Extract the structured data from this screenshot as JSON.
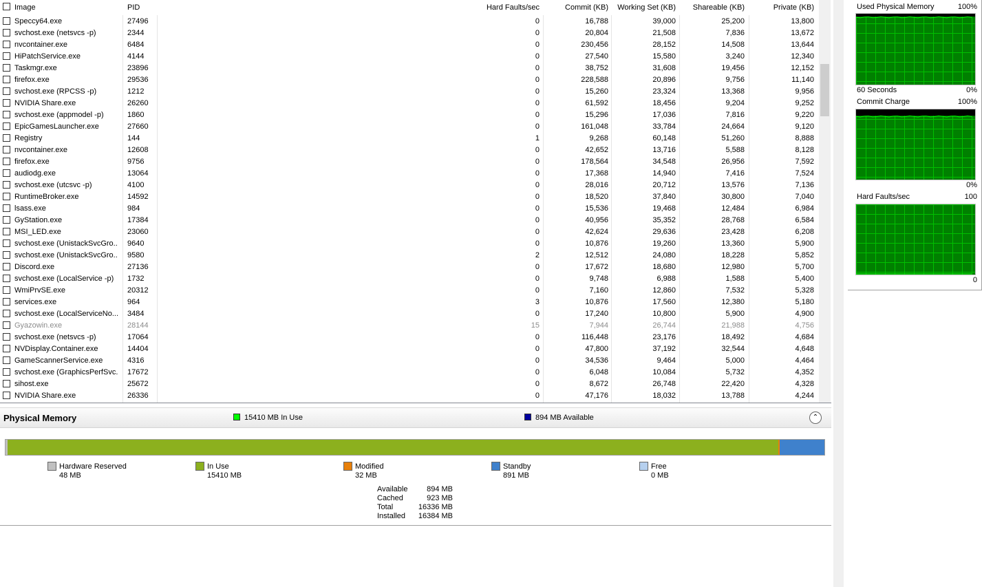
{
  "table": {
    "headers": {
      "image": "Image",
      "pid": "PID",
      "hard_faults": "Hard Faults/sec",
      "commit": "Commit (KB)",
      "working_set": "Working Set (KB)",
      "shareable": "Shareable (KB)",
      "private": "Private (KB)"
    },
    "rows": [
      {
        "image": "Speccy64.exe",
        "pid": "27496",
        "hf": "0",
        "commit": "16,788",
        "ws": "39,000",
        "shareable": "25,200",
        "private": "13,800"
      },
      {
        "image": "svchost.exe (netsvcs -p)",
        "pid": "2344",
        "hf": "0",
        "commit": "20,804",
        "ws": "21,508",
        "shareable": "7,836",
        "private": "13,672"
      },
      {
        "image": "nvcontainer.exe",
        "pid": "6484",
        "hf": "0",
        "commit": "230,456",
        "ws": "28,152",
        "shareable": "14,508",
        "private": "13,644"
      },
      {
        "image": "HiPatchService.exe",
        "pid": "4144",
        "hf": "0",
        "commit": "27,540",
        "ws": "15,580",
        "shareable": "3,240",
        "private": "12,340"
      },
      {
        "image": "Taskmgr.exe",
        "pid": "23896",
        "hf": "0",
        "commit": "38,752",
        "ws": "31,608",
        "shareable": "19,456",
        "private": "12,152"
      },
      {
        "image": "firefox.exe",
        "pid": "29536",
        "hf": "0",
        "commit": "228,588",
        "ws": "20,896",
        "shareable": "9,756",
        "private": "11,140"
      },
      {
        "image": "svchost.exe (RPCSS -p)",
        "pid": "1212",
        "hf": "0",
        "commit": "15,260",
        "ws": "23,324",
        "shareable": "13,368",
        "private": "9,956"
      },
      {
        "image": "NVIDIA Share.exe",
        "pid": "26260",
        "hf": "0",
        "commit": "61,592",
        "ws": "18,456",
        "shareable": "9,204",
        "private": "9,252"
      },
      {
        "image": "svchost.exe (appmodel -p)",
        "pid": "1860",
        "hf": "0",
        "commit": "15,296",
        "ws": "17,036",
        "shareable": "7,816",
        "private": "9,220"
      },
      {
        "image": "EpicGamesLauncher.exe",
        "pid": "27660",
        "hf": "0",
        "commit": "161,048",
        "ws": "33,784",
        "shareable": "24,664",
        "private": "9,120"
      },
      {
        "image": "Registry",
        "pid": "144",
        "hf": "1",
        "commit": "9,268",
        "ws": "60,148",
        "shareable": "51,260",
        "private": "8,888"
      },
      {
        "image": "nvcontainer.exe",
        "pid": "12608",
        "hf": "0",
        "commit": "42,652",
        "ws": "13,716",
        "shareable": "5,588",
        "private": "8,128"
      },
      {
        "image": "firefox.exe",
        "pid": "9756",
        "hf": "0",
        "commit": "178,564",
        "ws": "34,548",
        "shareable": "26,956",
        "private": "7,592"
      },
      {
        "image": "audiodg.exe",
        "pid": "13064",
        "hf": "0",
        "commit": "17,368",
        "ws": "14,940",
        "shareable": "7,416",
        "private": "7,524"
      },
      {
        "image": "svchost.exe (utcsvc -p)",
        "pid": "4100",
        "hf": "0",
        "commit": "28,016",
        "ws": "20,712",
        "shareable": "13,576",
        "private": "7,136"
      },
      {
        "image": "RuntimeBroker.exe",
        "pid": "14592",
        "hf": "0",
        "commit": "18,520",
        "ws": "37,840",
        "shareable": "30,800",
        "private": "7,040"
      },
      {
        "image": "lsass.exe",
        "pid": "984",
        "hf": "0",
        "commit": "15,536",
        "ws": "19,468",
        "shareable": "12,484",
        "private": "6,984"
      },
      {
        "image": "GyStation.exe",
        "pid": "17384",
        "hf": "0",
        "commit": "40,956",
        "ws": "35,352",
        "shareable": "28,768",
        "private": "6,584"
      },
      {
        "image": "MSI_LED.exe",
        "pid": "23060",
        "hf": "0",
        "commit": "42,624",
        "ws": "29,636",
        "shareable": "23,428",
        "private": "6,208"
      },
      {
        "image": "svchost.exe (UnistackSvcGro...",
        "pid": "9640",
        "hf": "0",
        "commit": "10,876",
        "ws": "19,260",
        "shareable": "13,360",
        "private": "5,900"
      },
      {
        "image": "svchost.exe (UnistackSvcGro...",
        "pid": "9580",
        "hf": "2",
        "commit": "12,512",
        "ws": "24,080",
        "shareable": "18,228",
        "private": "5,852"
      },
      {
        "image": "Discord.exe",
        "pid": "27136",
        "hf": "0",
        "commit": "17,672",
        "ws": "18,680",
        "shareable": "12,980",
        "private": "5,700"
      },
      {
        "image": "svchost.exe (LocalService -p)",
        "pid": "1732",
        "hf": "0",
        "commit": "9,748",
        "ws": "6,988",
        "shareable": "1,588",
        "private": "5,400"
      },
      {
        "image": "WmiPrvSE.exe",
        "pid": "20312",
        "hf": "0",
        "commit": "7,160",
        "ws": "12,860",
        "shareable": "7,532",
        "private": "5,328"
      },
      {
        "image": "services.exe",
        "pid": "964",
        "hf": "3",
        "commit": "10,876",
        "ws": "17,560",
        "shareable": "12,380",
        "private": "5,180"
      },
      {
        "image": "svchost.exe (LocalServiceNo...",
        "pid": "3484",
        "hf": "0",
        "commit": "17,240",
        "ws": "10,800",
        "shareable": "5,900",
        "private": "4,900"
      },
      {
        "image": "Gyazowin.exe",
        "pid": "28144",
        "hf": "15",
        "commit": "7,944",
        "ws": "26,744",
        "shareable": "21,988",
        "private": "4,756",
        "dim": true
      },
      {
        "image": "svchost.exe (netsvcs -p)",
        "pid": "17064",
        "hf": "0",
        "commit": "116,448",
        "ws": "23,176",
        "shareable": "18,492",
        "private": "4,684"
      },
      {
        "image": "NVDisplay.Container.exe",
        "pid": "14404",
        "hf": "0",
        "commit": "47,800",
        "ws": "37,192",
        "shareable": "32,544",
        "private": "4,648"
      },
      {
        "image": "GameScannerService.exe",
        "pid": "4316",
        "hf": "0",
        "commit": "34,536",
        "ws": "9,464",
        "shareable": "5,000",
        "private": "4,464"
      },
      {
        "image": "svchost.exe (GraphicsPerfSvc...",
        "pid": "17672",
        "hf": "0",
        "commit": "6,048",
        "ws": "10,084",
        "shareable": "5,732",
        "private": "4,352"
      },
      {
        "image": "sihost.exe",
        "pid": "25672",
        "hf": "0",
        "commit": "8,672",
        "ws": "26,748",
        "shareable": "22,420",
        "private": "4,328"
      },
      {
        "image": "NVIDIA Share.exe",
        "pid": "26336",
        "hf": "0",
        "commit": "47,176",
        "ws": "18,032",
        "shareable": "13,788",
        "private": "4,244"
      }
    ]
  },
  "physical_memory": {
    "title": "Physical Memory",
    "in_use_summary": "15410 MB In Use",
    "available_summary": "894 MB Available",
    "collapse_icon": "chevron-up-icon",
    "bar": [
      {
        "name": "hardware-reserved",
        "fraction": 0.0029,
        "color": "#c0c0c0"
      },
      {
        "name": "in-use",
        "fraction": 0.9405,
        "color": "#8cb01e"
      },
      {
        "name": "modified",
        "fraction": 0.002,
        "color": "#e8800a"
      },
      {
        "name": "standby",
        "fraction": 0.0546,
        "color": "#3f81cc"
      },
      {
        "name": "free",
        "fraction": 0.0,
        "color": "#b6d0ee"
      }
    ],
    "legend": [
      {
        "label": "Hardware Reserved",
        "value": "48 MB",
        "color": "#c0c0c0"
      },
      {
        "label": "In Use",
        "value": "15410 MB",
        "color": "#8cb01e"
      },
      {
        "label": "Modified",
        "value": "32 MB",
        "color": "#e8800a"
      },
      {
        "label": "Standby",
        "value": "891 MB",
        "color": "#3f81cc"
      },
      {
        "label": "Free",
        "value": "0 MB",
        "color": "#b6d0ee"
      }
    ],
    "stats": [
      {
        "label": "Available",
        "value": "894 MB"
      },
      {
        "label": "Cached",
        "value": "923 MB"
      },
      {
        "label": "Total",
        "value": "16336 MB"
      },
      {
        "label": "Installed",
        "value": "16384 MB"
      }
    ]
  },
  "graphs": {
    "used_physical": {
      "title": "Used Physical Memory",
      "max": "100%",
      "time_label": "60 Seconds",
      "min": "0%",
      "level": 0.95
    },
    "commit_charge": {
      "title": "Commit Charge",
      "max": "100%",
      "min": "0%",
      "level": 0.9
    },
    "hard_faults": {
      "title": "Hard Faults/sec",
      "max": "100",
      "min": "0",
      "level": 0.0
    }
  },
  "colors": {
    "graph_bg": "#008000",
    "graph_grid": "#00c000",
    "graph_line": "#00ff00"
  }
}
